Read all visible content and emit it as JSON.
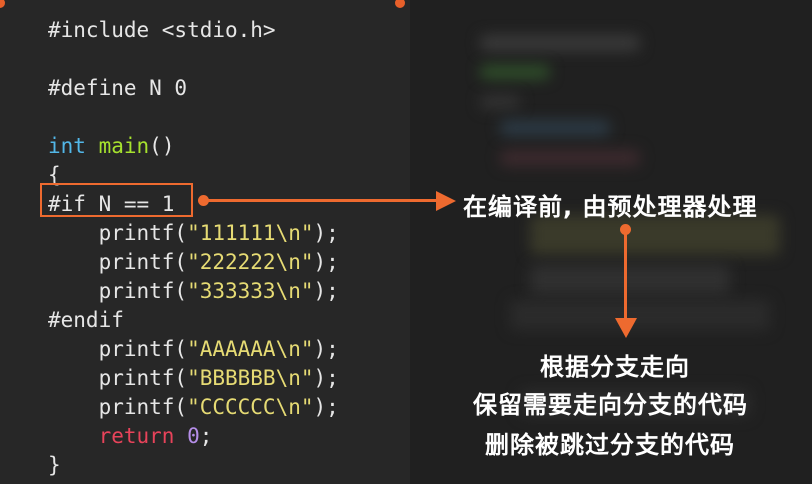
{
  "code": {
    "lines": [
      [
        {
          "t": "#include <stdio.h>",
          "c": ""
        }
      ],
      [],
      [
        {
          "t": "#define N 0",
          "c": ""
        }
      ],
      [],
      [
        {
          "t": "int",
          "c": "kw-int"
        },
        {
          "t": " ",
          "c": ""
        },
        {
          "t": "main",
          "c": "fn"
        },
        {
          "t": "()",
          "c": ""
        }
      ],
      [
        {
          "t": "{",
          "c": ""
        }
      ],
      [
        {
          "t": "#if N == 1",
          "c": ""
        }
      ],
      [
        {
          "t": "    printf(",
          "c": ""
        },
        {
          "t": "\"111111\\n\"",
          "c": "str"
        },
        {
          "t": ");",
          "c": ""
        }
      ],
      [
        {
          "t": "    printf(",
          "c": ""
        },
        {
          "t": "\"222222\\n\"",
          "c": "str"
        },
        {
          "t": ");",
          "c": ""
        }
      ],
      [
        {
          "t": "    printf(",
          "c": ""
        },
        {
          "t": "\"333333\\n\"",
          "c": "str"
        },
        {
          "t": ");",
          "c": ""
        }
      ],
      [
        {
          "t": "#endif",
          "c": ""
        }
      ],
      [
        {
          "t": "    printf(",
          "c": ""
        },
        {
          "t": "\"AAAAAA\\n\"",
          "c": "str"
        },
        {
          "t": ");",
          "c": ""
        }
      ],
      [
        {
          "t": "    printf(",
          "c": ""
        },
        {
          "t": "\"BBBBBB\\n\"",
          "c": "str"
        },
        {
          "t": ");",
          "c": ""
        }
      ],
      [
        {
          "t": "    printf(",
          "c": ""
        },
        {
          "t": "\"CCCCCC\\n\"",
          "c": "str"
        },
        {
          "t": ");",
          "c": ""
        }
      ],
      [
        {
          "t": "    ",
          "c": ""
        },
        {
          "t": "return",
          "c": "ret"
        },
        {
          "t": " ",
          "c": ""
        },
        {
          "t": "0",
          "c": "num"
        },
        {
          "t": ";",
          "c": ""
        }
      ],
      [
        {
          "t": "}",
          "c": ""
        }
      ]
    ]
  },
  "annotations": {
    "preprocess": "在编译前, 由预处理器处理",
    "line1": "根据分支走向",
    "line2": "保留需要走向分支的代码",
    "line3": "删除被跳过分支的代码"
  },
  "colors": {
    "accent": "#ee6a2f",
    "panel": "#272727",
    "keyword": "#52b7e8",
    "function": "#a6e22e",
    "string": "#e6db74",
    "return": "#e8435a",
    "number": "#b58ee8"
  }
}
